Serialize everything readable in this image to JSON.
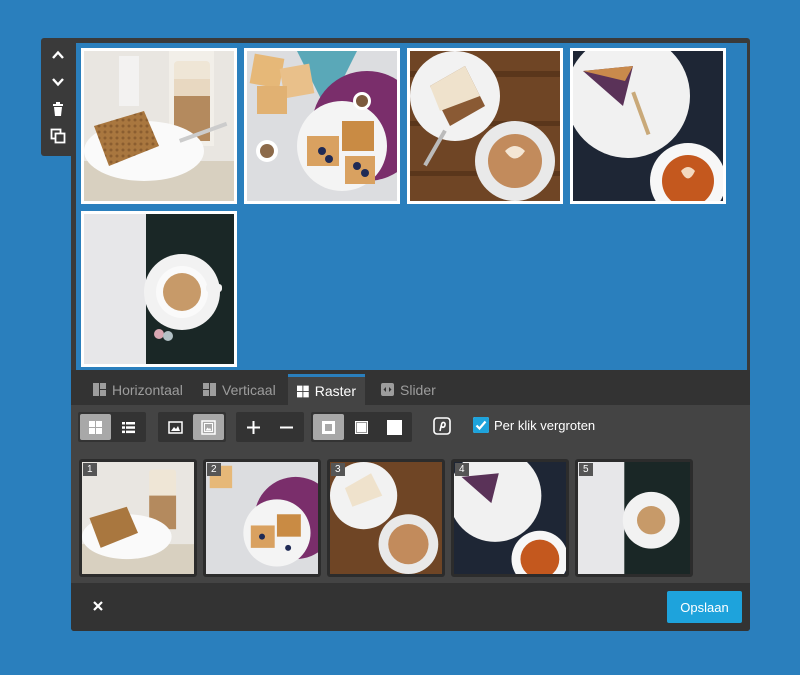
{
  "side_toolbar": {
    "icons": [
      "chevron-up-icon",
      "chevron-down-icon",
      "trash-icon",
      "copy-icon"
    ]
  },
  "tabs": [
    {
      "label": "Horizontaal",
      "icon": "layout-horizontal-icon",
      "active": false
    },
    {
      "label": "Verticaal",
      "icon": "layout-vertical-icon",
      "active": false
    },
    {
      "label": "Raster",
      "icon": "grid-icon",
      "active": true
    },
    {
      "label": "Slider",
      "icon": "slider-icon",
      "active": false
    }
  ],
  "options": {
    "zoom_on_click_label": "Per klik vergroten",
    "zoom_on_click_checked": true
  },
  "thumbnails": [
    {
      "number": "1"
    },
    {
      "number": "2"
    },
    {
      "number": "3"
    },
    {
      "number": "4"
    },
    {
      "number": "5"
    }
  ],
  "footer": {
    "save_label": "Opslaan",
    "close_icon": "close-icon"
  },
  "colors": {
    "background": "#2a7fbd",
    "panel": "#3a3a3a",
    "accent": "#1ea3dc"
  }
}
